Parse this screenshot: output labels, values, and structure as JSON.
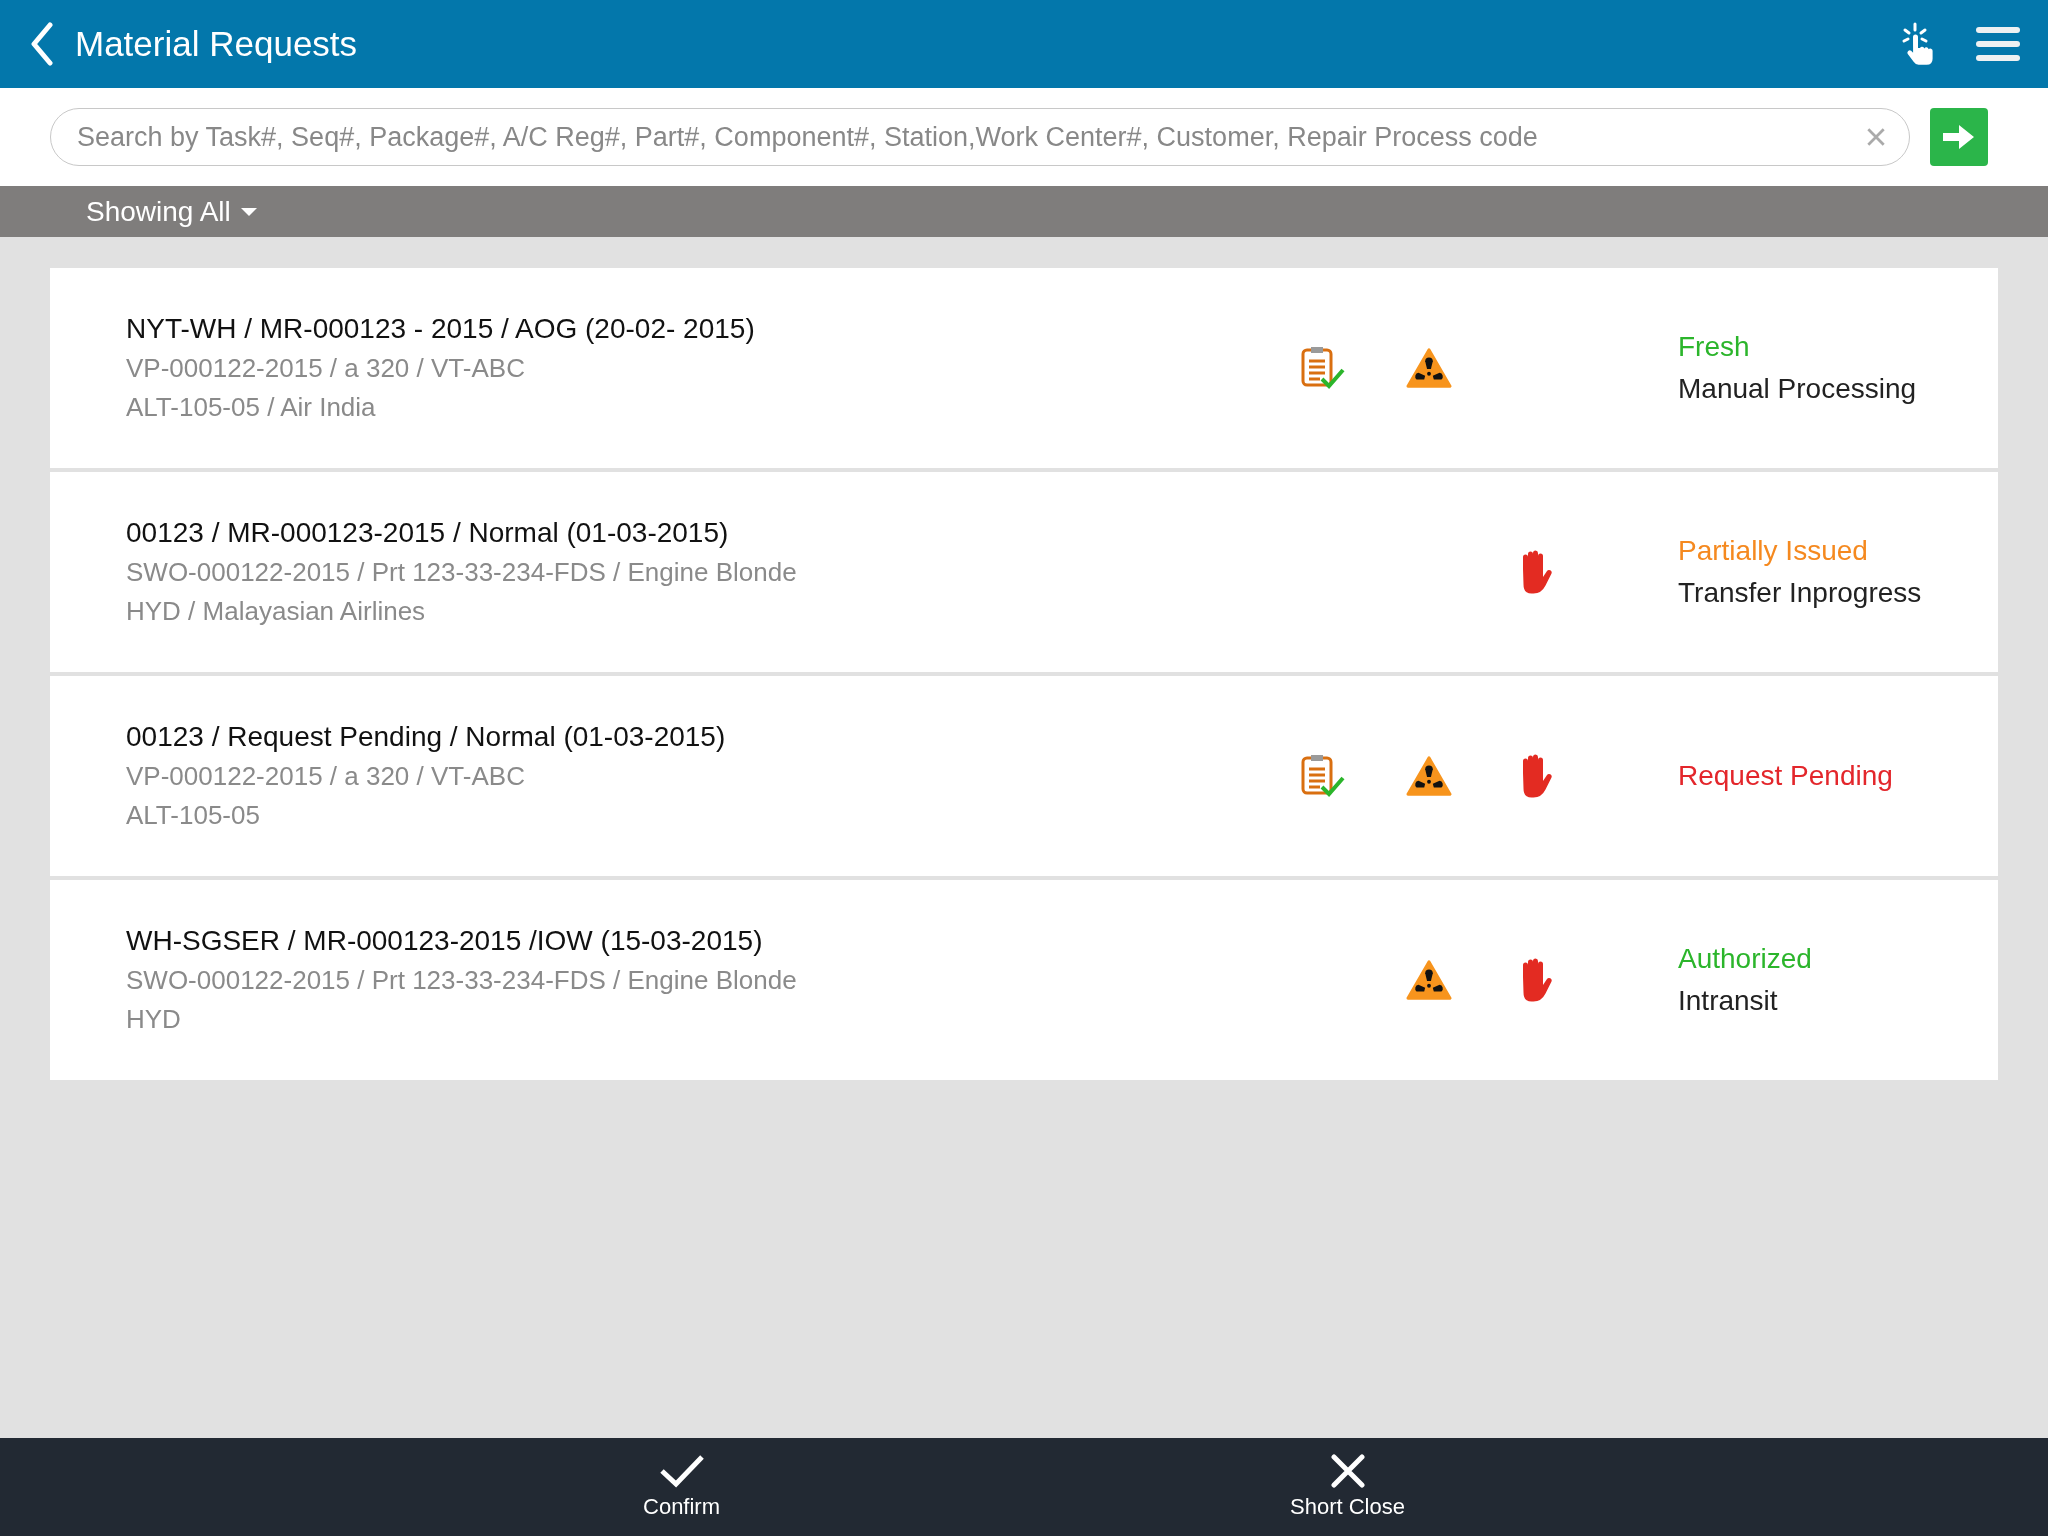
{
  "header": {
    "title": "Material Requests"
  },
  "search": {
    "placeholder": "Search by Task#, Seq#, Package#, A/C Reg#, Part#, Component#, Station,Work Center#, Customer, Repair Process code"
  },
  "filter": {
    "label": "Showing All"
  },
  "requests": [
    {
      "title": "NYT-WH / MR-000123 - 2015 / AOG (20-02- 2015)",
      "line_2": "VP-000122-2015 / a 320 / VT-ABC",
      "line_3": "ALT-105-05 / Air India",
      "checklist": true,
      "hazard": true,
      "hold": false,
      "status": {
        "text": "Fresh",
        "color": "#2bb52b"
      },
      "substatus": "Manual Processing"
    },
    {
      "title": "00123 / MR-000123-2015 / Normal (01-03-2015)",
      "line_2": "SWO-000122-2015 / Prt 123-33-234-FDS / Engine Blonde",
      "line_3": "HYD / Malayasian Airlines",
      "checklist": false,
      "hazard": false,
      "hold": true,
      "status": {
        "text": "Partially Issued",
        "color": "#f5891f"
      },
      "substatus": "Transfer Inprogress"
    },
    {
      "title": "00123 / Request Pending / Normal (01-03-2015)",
      "line_2": "VP-000122-2015 / a 320 / VT-ABC",
      "line_3": "ALT-105-05",
      "checklist": true,
      "hazard": true,
      "hold": true,
      "status": {
        "text": "Request Pending",
        "color": "#e3262b"
      }
    },
    {
      "title": "WH-SGSER / MR-000123-2015 /IOW (15-03-2015)",
      "line_2": "SWO-000122-2015 / Prt 123-33-234-FDS / Engine Blonde",
      "line_3": "HYD",
      "checklist": false,
      "hazard": true,
      "hold": true,
      "status": {
        "text": "Authorized",
        "color": "#2bb52b"
      },
      "substatus": "Intransit"
    }
  ],
  "actions": [
    {
      "kind": "confirm",
      "label": "Confirm"
    },
    {
      "kind": "close",
      "label": "Short Close"
    }
  ]
}
